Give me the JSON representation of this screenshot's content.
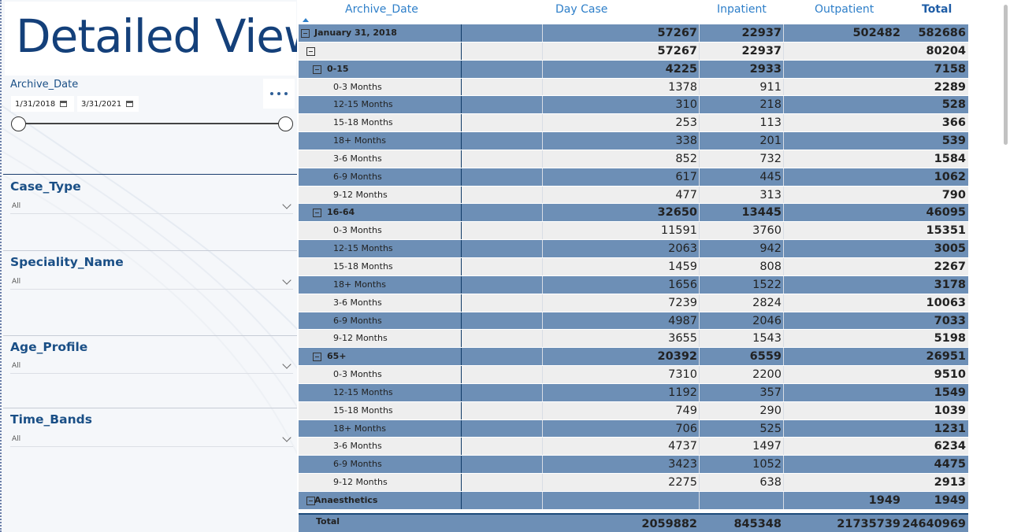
{
  "page": {
    "title": "Detailed View"
  },
  "slicers": {
    "archive_date": {
      "title": "Archive_Date",
      "start": "1/31/2018",
      "end": "3/31/2021"
    },
    "case_type": {
      "title": "Case_Type",
      "value": "All"
    },
    "speciality_name": {
      "title": "Speciality_Name",
      "value": "All"
    },
    "age_profile": {
      "title": "Age_Profile",
      "value": "All"
    },
    "time_bands": {
      "title": "Time_Bands",
      "value": "All"
    }
  },
  "matrix": {
    "columns": [
      "Archive_Date",
      "Day Case",
      "Inpatient",
      "Outpatient",
      "Total"
    ],
    "rows": [
      {
        "level": 0,
        "label": "January 31, 2018",
        "expand": true,
        "day_case": "57267",
        "inpatient": "22937",
        "outpatient": "502482",
        "total": "582686",
        "style": "blue"
      },
      {
        "level": 1,
        "label": "",
        "expand": true,
        "day_case": "57267",
        "inpatient": "22937",
        "outpatient": "",
        "total": "80204",
        "style": "grey"
      },
      {
        "level": 2,
        "label": "0-15",
        "expand": true,
        "day_case": "4225",
        "inpatient": "2933",
        "outpatient": "",
        "total": "7158",
        "style": "blue"
      },
      {
        "level": 3,
        "label": "0-3 Months",
        "day_case": "1378",
        "inpatient": "911",
        "outpatient": "",
        "total": "2289",
        "style": "grey"
      },
      {
        "level": 3,
        "label": "12-15 Months",
        "day_case": "310",
        "inpatient": "218",
        "outpatient": "",
        "total": "528",
        "style": "blue"
      },
      {
        "level": 3,
        "label": "15-18 Months",
        "day_case": "253",
        "inpatient": "113",
        "outpatient": "",
        "total": "366",
        "style": "grey"
      },
      {
        "level": 3,
        "label": "18+ Months",
        "day_case": "338",
        "inpatient": "201",
        "outpatient": "",
        "total": "539",
        "style": "blue"
      },
      {
        "level": 3,
        "label": "3-6 Months",
        "day_case": "852",
        "inpatient": "732",
        "outpatient": "",
        "total": "1584",
        "style": "grey"
      },
      {
        "level": 3,
        "label": "6-9 Months",
        "day_case": "617",
        "inpatient": "445",
        "outpatient": "",
        "total": "1062",
        "style": "blue"
      },
      {
        "level": 3,
        "label": "9-12 Months",
        "day_case": "477",
        "inpatient": "313",
        "outpatient": "",
        "total": "790",
        "style": "grey"
      },
      {
        "level": 2,
        "label": "16-64",
        "expand": true,
        "day_case": "32650",
        "inpatient": "13445",
        "outpatient": "",
        "total": "46095",
        "style": "blue"
      },
      {
        "level": 3,
        "label": "0-3 Months",
        "day_case": "11591",
        "inpatient": "3760",
        "outpatient": "",
        "total": "15351",
        "style": "grey"
      },
      {
        "level": 3,
        "label": "12-15 Months",
        "day_case": "2063",
        "inpatient": "942",
        "outpatient": "",
        "total": "3005",
        "style": "blue"
      },
      {
        "level": 3,
        "label": "15-18 Months",
        "day_case": "1459",
        "inpatient": "808",
        "outpatient": "",
        "total": "2267",
        "style": "grey"
      },
      {
        "level": 3,
        "label": "18+ Months",
        "day_case": "1656",
        "inpatient": "1522",
        "outpatient": "",
        "total": "3178",
        "style": "blue"
      },
      {
        "level": 3,
        "label": "3-6 Months",
        "day_case": "7239",
        "inpatient": "2824",
        "outpatient": "",
        "total": "10063",
        "style": "grey"
      },
      {
        "level": 3,
        "label": "6-9 Months",
        "day_case": "4987",
        "inpatient": "2046",
        "outpatient": "",
        "total": "7033",
        "style": "blue"
      },
      {
        "level": 3,
        "label": "9-12 Months",
        "day_case": "3655",
        "inpatient": "1543",
        "outpatient": "",
        "total": "5198",
        "style": "grey"
      },
      {
        "level": 2,
        "label": "65+",
        "expand": true,
        "day_case": "20392",
        "inpatient": "6559",
        "outpatient": "",
        "total": "26951",
        "style": "blue"
      },
      {
        "level": 3,
        "label": "0-3 Months",
        "day_case": "7310",
        "inpatient": "2200",
        "outpatient": "",
        "total": "9510",
        "style": "grey"
      },
      {
        "level": 3,
        "label": "12-15 Months",
        "day_case": "1192",
        "inpatient": "357",
        "outpatient": "",
        "total": "1549",
        "style": "blue"
      },
      {
        "level": 3,
        "label": "15-18 Months",
        "day_case": "749",
        "inpatient": "290",
        "outpatient": "",
        "total": "1039",
        "style": "grey"
      },
      {
        "level": 3,
        "label": "18+ Months",
        "day_case": "706",
        "inpatient": "525",
        "outpatient": "",
        "total": "1231",
        "style": "blue"
      },
      {
        "level": 3,
        "label": "3-6 Months",
        "day_case": "4737",
        "inpatient": "1497",
        "outpatient": "",
        "total": "6234",
        "style": "grey"
      },
      {
        "level": 3,
        "label": "6-9 Months",
        "day_case": "3423",
        "inpatient": "1052",
        "outpatient": "",
        "total": "4475",
        "style": "blue"
      },
      {
        "level": 3,
        "label": "9-12 Months",
        "day_case": "2275",
        "inpatient": "638",
        "outpatient": "",
        "total": "2913",
        "style": "grey"
      },
      {
        "level": 1,
        "label": "Anaesthetics",
        "expand": true,
        "day_case": "",
        "inpatient": "",
        "outpatient": "1949",
        "total": "1949",
        "style": "blue"
      }
    ],
    "total_row": {
      "label": "Total",
      "day_case": "2059882",
      "inpatient": "845348",
      "outpatient": "21735739",
      "total": "24640969"
    }
  },
  "colors": {
    "row_blue": "#6d8fb6",
    "row_grey": "#eeeeee",
    "title": "#14407a",
    "header": "#2e7fc9"
  }
}
